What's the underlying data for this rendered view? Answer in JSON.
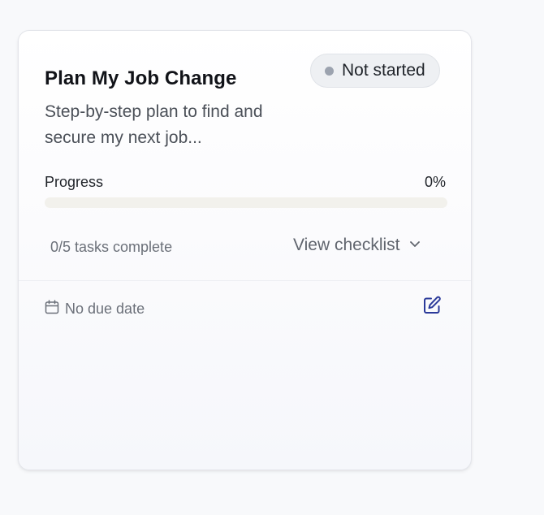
{
  "card": {
    "title": "Plan My Job Change",
    "description": "Step-by-step plan to find and secure my next job...",
    "status": {
      "label": "Not started",
      "dot_color": "#9ca3af"
    },
    "progress": {
      "label": "Progress",
      "value_text": "0%",
      "fraction": 0
    },
    "tasks_summary": "0/5 tasks complete",
    "view_checklist_label": "View checklist",
    "due_date_text": "No due date",
    "icons": {
      "calendar": "calendar-icon",
      "chevron": "chevron-down-icon",
      "edit": "edit-icon"
    },
    "colors": {
      "accent": "#3b4fa8",
      "edit_icon": "#2b3a9a",
      "track": "#f2f1ec"
    }
  }
}
